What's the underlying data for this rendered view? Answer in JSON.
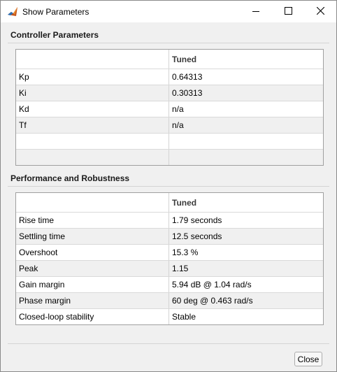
{
  "window": {
    "title": "Show Parameters",
    "app_icon": "matlab-icon",
    "controls": {
      "minimize": "minimize-icon",
      "maximize": "maximize-icon",
      "close": "close-icon"
    }
  },
  "controller": {
    "section_title": "Controller Parameters",
    "header": [
      "",
      "Tuned"
    ],
    "rows": [
      {
        "label": "Kp",
        "value": "0.64313"
      },
      {
        "label": "Ki",
        "value": "0.30313"
      },
      {
        "label": "Kd",
        "value": "n/a"
      },
      {
        "label": "Tf",
        "value": "n/a"
      },
      {
        "label": "",
        "value": ""
      },
      {
        "label": "",
        "value": ""
      }
    ]
  },
  "performance": {
    "section_title": "Performance and Robustness",
    "header": [
      "",
      "Tuned"
    ],
    "rows": [
      {
        "label": "Rise time",
        "value": "1.79 seconds"
      },
      {
        "label": "Settling time",
        "value": "12.5 seconds"
      },
      {
        "label": "Overshoot",
        "value": "15.3 %"
      },
      {
        "label": "Peak",
        "value": "1.15"
      },
      {
        "label": "Gain margin",
        "value": "5.94 dB @ 1.04 rad/s"
      },
      {
        "label": "Phase margin",
        "value": "60 deg @ 0.463 rad/s"
      },
      {
        "label": "Closed-loop stability",
        "value": "Stable"
      }
    ]
  },
  "footer": {
    "close_label": "Close"
  }
}
